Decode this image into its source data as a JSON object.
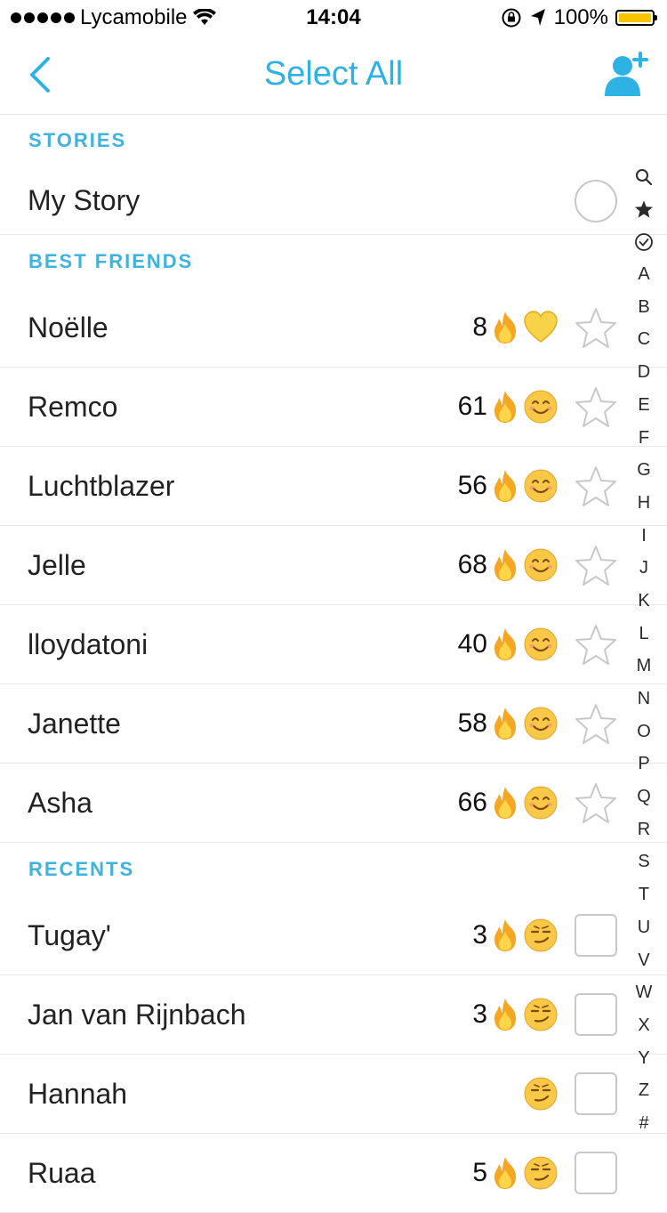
{
  "status": {
    "carrier": "Lycamobile",
    "time": "14:04",
    "battery": "100%"
  },
  "nav": {
    "title": "Select All"
  },
  "sections": {
    "stories": "STORIES",
    "best_friends": "BEST FRIENDS",
    "recents": "RECENTS"
  },
  "stories": [
    {
      "name": "My Story"
    }
  ],
  "best_friends": [
    {
      "name": "Noëlle",
      "score": "8",
      "emoji": "yellow-heart"
    },
    {
      "name": "Remco",
      "score": "61",
      "emoji": "smile"
    },
    {
      "name": "Luchtblazer",
      "score": "56",
      "emoji": "smile"
    },
    {
      "name": "Jelle",
      "score": "68",
      "emoji": "smile"
    },
    {
      "name": "lloydatoni",
      "score": "40",
      "emoji": "smile"
    },
    {
      "name": "Janette",
      "score": "58",
      "emoji": "smile"
    },
    {
      "name": "Asha",
      "score": "66",
      "emoji": "smile"
    }
  ],
  "recents": [
    {
      "name": "Tugay'",
      "score": "3",
      "emoji": "smirk"
    },
    {
      "name": "Jan van Rijnbach",
      "score": "3",
      "emoji": "smirk"
    },
    {
      "name": "Hannah",
      "score": "",
      "emoji": "smirk"
    },
    {
      "name": "Ruaa",
      "score": "5",
      "emoji": "smirk"
    }
  ],
  "index": [
    "search-icon",
    "star-icon",
    "check-icon",
    "A",
    "B",
    "C",
    "D",
    "E",
    "F",
    "G",
    "H",
    "I",
    "J",
    "K",
    "L",
    "M",
    "N",
    "O",
    "P",
    "Q",
    "R",
    "S",
    "T",
    "U",
    "V",
    "W",
    "X",
    "Y",
    "Z",
    "#"
  ],
  "colors": {
    "accent": "#2eb2e3",
    "section": "#3fb3dd"
  }
}
